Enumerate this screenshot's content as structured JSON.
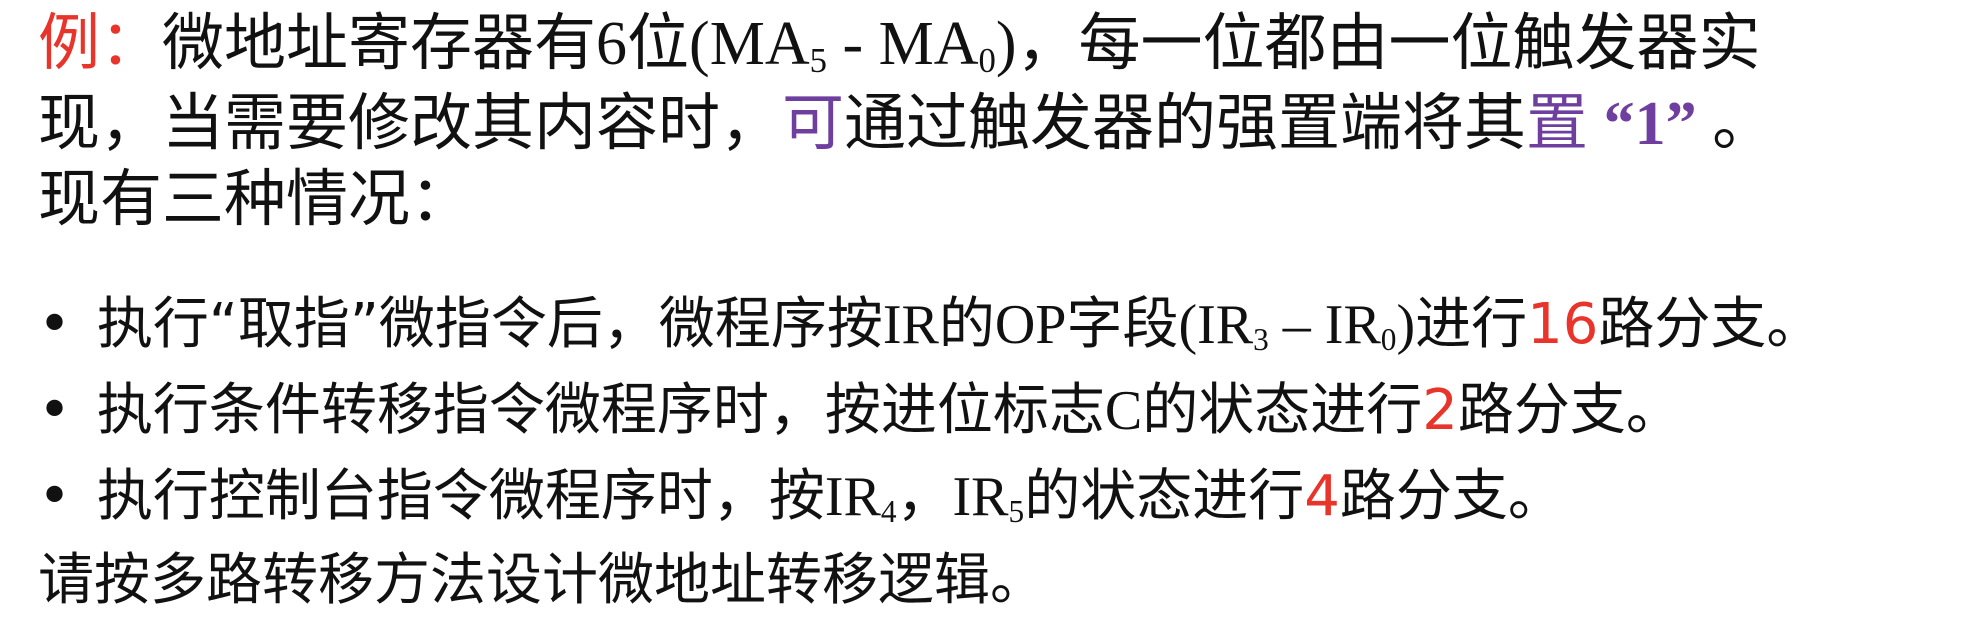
{
  "intro": {
    "example_label": "例：",
    "line1_a": "微地址寄存器有",
    "line1_six": "6",
    "line1_b": "位",
    "line1_expr_open": "(MA",
    "line1_expr_sub1": "5",
    "line1_expr_dash": " - MA",
    "line1_expr_sub2": "0",
    "line1_expr_close": ")",
    "line1_c": "，每一位都由一位触发器实",
    "line2_a": "现，当需要修改其内容时，",
    "line2_highlight1": "可",
    "line2_b": "通过触发器的强置端将其",
    "line2_highlight2": "置",
    "line2_quote": " “1” ",
    "line2_end": "。",
    "line3": "现有三种情况："
  },
  "bullets": [
    {
      "dot": "•",
      "text_a": " 执行“取指”微指令后，微程序按",
      "ir_a": "IR",
      "text_b": "的",
      "op": "OP",
      "text_c": "字段",
      "expr_open": "(IR",
      "expr_sub1": "3",
      "expr_dash": " – IR",
      "expr_sub2": "0",
      "expr_close": ")",
      "text_d": "进行",
      "number": "16",
      "text_e": "路分支。"
    },
    {
      "dot": "•",
      "text_a": " 执行条件转移指令微程序时，按进位标志",
      "flag": "C",
      "text_b": "的状态进行",
      "number": "2",
      "text_c": "路分支。"
    },
    {
      "dot": "•",
      "text_a": " 执行控制台指令微程序时，按",
      "ir_a": "IR",
      "ir_a_sub": "4",
      "sep": "，",
      "ir_b": "IR",
      "ir_b_sub": "5",
      "text_b": "的状态进行",
      "number": "4",
      "text_c": "路分支。"
    }
  ],
  "closing": "请按多路转移方法设计微地址转移逻辑。",
  "colors": {
    "highlight_red": "#e8342a",
    "highlight_purple": "#6f3fa0",
    "text": "#111111"
  }
}
